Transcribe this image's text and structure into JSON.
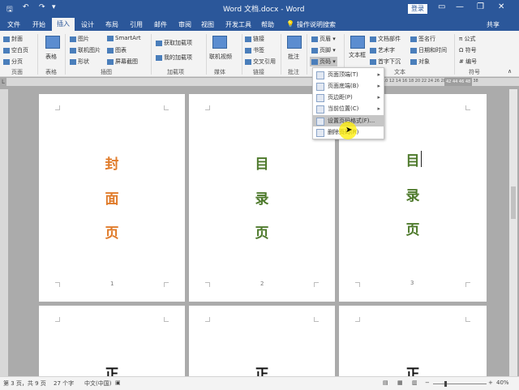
{
  "title_bar": {
    "title": "Word 文档.docx - Word",
    "login_label": "登录",
    "minimize": "—",
    "restore": "❐",
    "close": "✕"
  },
  "quick_access": {
    "save": "🖫",
    "undo": "↶",
    "redo": "↷",
    "customize": "▾"
  },
  "tabs": [
    "文件",
    "开始",
    "插入",
    "设计",
    "布局",
    "引用",
    "邮件",
    "审阅",
    "视图",
    "开发工具",
    "帮助",
    "操作说明搜索"
  ],
  "share_label": "共享",
  "ribbon": {
    "pages_group": {
      "label": "页面",
      "cover": "封面",
      "blank": "空白页",
      "break": "分页"
    },
    "table_group": {
      "label": "表格",
      "table": "表格"
    },
    "illustrations_group": {
      "label": "插图",
      "picture": "图片",
      "online_picture": "联机图片",
      "shapes": "形状",
      "smartart": "SmartArt",
      "chart": "图表",
      "screenshot": "屏幕截图"
    },
    "addins_group": {
      "label": "加载项",
      "get_addins": "获取加载项",
      "my_addins": "我的加载项"
    },
    "media_group": {
      "label": "媒体",
      "online_video": "联机视频"
    },
    "links_group": {
      "label": "链接",
      "link": "链接",
      "bookmark": "书签",
      "cross_ref": "交叉引用"
    },
    "comments_group": {
      "label": "批注",
      "comment": "批注"
    },
    "header_footer": {
      "header": "页眉",
      "footer": "页脚",
      "page_number": "页码"
    },
    "text_group": {
      "label": "文本",
      "textbox": "文本框",
      "quick_parts": "文档部件",
      "wordart": "艺术字",
      "dropcap": "首字下沉",
      "signature": "签名行",
      "datetime": "日期和时间",
      "object": "对象"
    },
    "symbols_group": {
      "label": "符号",
      "equation": "公式",
      "symbol": "符号",
      "number": "编号"
    }
  },
  "ruler_text": "10 12 14 16 18 20 22 24 26 28 30 32 34 36 38",
  "ruler_highlight": "42 44 46 48",
  "page_number_menu": [
    {
      "label": "页面顶端(T)",
      "has_arrow": true
    },
    {
      "label": "页面底端(B)",
      "has_arrow": true
    },
    {
      "label": "页边距(P)",
      "has_arrow": true
    },
    {
      "label": "当前位置(C)",
      "has_arrow": true
    },
    {
      "label": "设置页码格式(F)...",
      "has_arrow": false
    },
    {
      "label": "删除页码(R)",
      "has_arrow": false
    }
  ],
  "pages": [
    {
      "chars": [
        "封",
        "面",
        "页"
      ],
      "number": "1",
      "color": "#e07b2a"
    },
    {
      "chars": [
        "目",
        "录",
        "页"
      ],
      "number": "2",
      "color": "#4e7a2c"
    },
    {
      "chars": [
        "目",
        "录",
        "页"
      ],
      "number": "3",
      "color": "#4e7a2c"
    }
  ],
  "bottom_pages_text": [
    "正",
    "正",
    "正"
  ],
  "status_bar": {
    "page": "第 3 页，共 9 页",
    "words": "27 个字",
    "language": "中文(中国)",
    "zoom": "40%"
  }
}
